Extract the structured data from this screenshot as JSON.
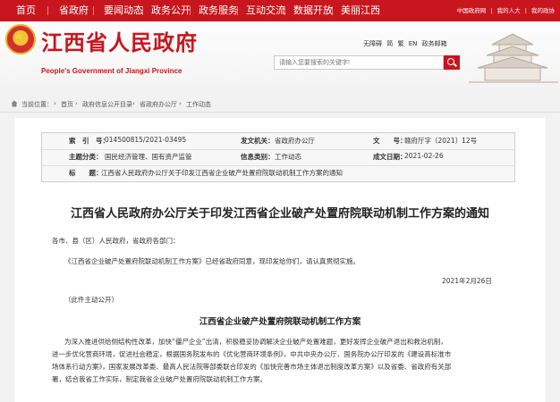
{
  "top_nav": {
    "items": [
      "首页",
      "省政府",
      "要闻动态",
      "政务公开",
      "政务服务",
      "互动交流",
      "数据开放",
      "美丽江西"
    ],
    "links": [
      "中国政府网",
      "|",
      "我的人大",
      "|",
      "我的政协"
    ],
    "color": "#c8161e"
  },
  "header": {
    "title": "江西省人民政府",
    "subtitle": "People's Government of Jiangxi Province",
    "tools": [
      "无障碍",
      "简",
      "繁",
      "EN",
      "政务邮箱"
    ],
    "search_placeholder": "请输入您要搜索的关键字!",
    "brand_color": "#c8161e"
  },
  "breadcrumb": [
    "当前位置：",
    "首页",
    "政府信息公开目录",
    "省政府办公厅",
    "工作动态"
  ],
  "meta": {
    "index_label": "索　引　号：",
    "index_value": "014500815/2021-03495",
    "issuer_label": "发文机关：",
    "issuer_value": "省政府办公厅",
    "docno_label": "文　　号：",
    "docno_value": "赣府厅字〔2021〕12号",
    "topic_label": "主题分类：",
    "topic_value": "国民经济管理、国有资产监管",
    "category_label": "信息类别：",
    "category_value": "工作动态",
    "date_label": "成文日期：",
    "date_value": "2021-02-26",
    "title_label": "标　　题：",
    "title_value": "江西省人民政府办公厅关于印发江西省企业破产处置府院联动机制工作方案的通知"
  },
  "document": {
    "title": "江西省人民政府办公厅关于印发江西省企业破产处置府院联动机制工作方案的通知",
    "salutation": "各市、县（区）人民政府，省政府各部门：",
    "body": "《江西省企业破产处置府院联动机制工作方案》已经省政府同意，现印发给你们，请认真贯彻实施。",
    "date": "2021年2月26日",
    "note": "（此件主动公开）",
    "section_title": "江西省企业破产处置府院联动机制工作方案",
    "para_lines": [
      "为深入推进供给侧结构性改革，加快“僵尸企业”出清，积极稳妥协调解决企业破产处置难题，更好发挥企业破产退出和救治机制，",
      "进一步优化营商环境，促进社会稳定，根据国务院发布的《优化营商环境条例》，中共中央办公厅、国务院办公厅印发的《建设高标准市",
      "场体系行动方案》，国家发展改革委、最高人民法院等部委联合印发的《加快完善市场主体退出制度改革方案》以及省委、省政府有关部",
      "署，结合我省工作实际，制定我省企业破产处置府院联动机制工作方案。"
    ]
  }
}
